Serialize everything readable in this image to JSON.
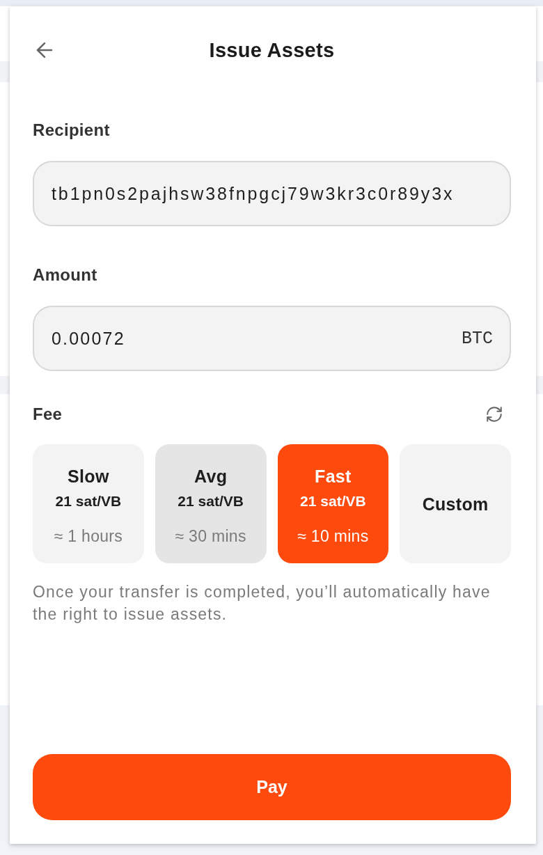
{
  "header": {
    "title": "Issue Assets"
  },
  "recipient": {
    "label": "Recipient",
    "value": "tb1pn0s2pajhsw38fnpgcj79w3kr3c0r89y3x"
  },
  "amount": {
    "label": "Amount",
    "value": "0.00072",
    "unit": "BTC"
  },
  "fee": {
    "label": "Fee",
    "options": [
      {
        "kind": "preset",
        "name": "Slow",
        "rate": "21 sat/VB",
        "time": "≈ 1 hours",
        "selected": false,
        "hovered": false
      },
      {
        "kind": "preset",
        "name": "Avg",
        "rate": "21 sat/VB",
        "time": "≈ 30 mins",
        "selected": false,
        "hovered": true
      },
      {
        "kind": "preset",
        "name": "Fast",
        "rate": "21 sat/VB",
        "time": "≈ 10 mins",
        "selected": true,
        "hovered": false
      },
      {
        "kind": "custom",
        "name": "Custom",
        "selected": false,
        "hovered": false
      }
    ],
    "note": "Once your transfer is completed, you’ll automatically have the right to issue assets."
  },
  "pay_button": {
    "label": "Pay"
  }
}
